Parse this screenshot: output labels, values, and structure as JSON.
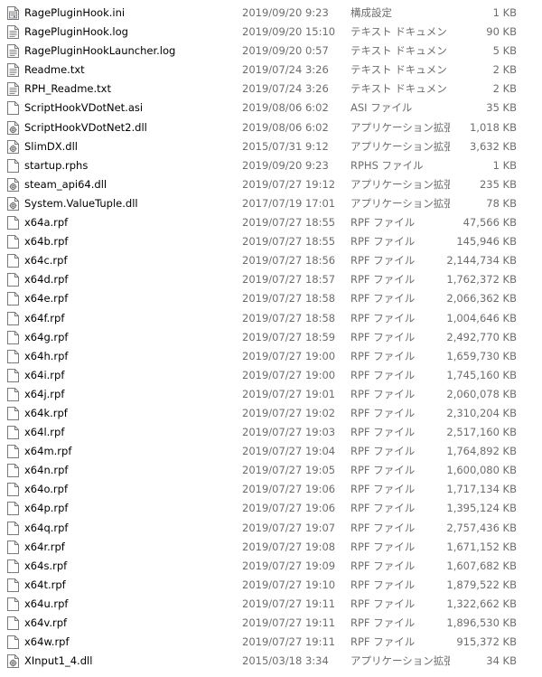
{
  "files": [
    {
      "name": "RagePluginHook.ini",
      "date": "2019/09/20 9:23",
      "type": "構成設定",
      "size": "1 KB",
      "icon": "settings-file-icon"
    },
    {
      "name": "RagePluginHook.log",
      "date": "2019/09/20 15:10",
      "type": "テキスト ドキュメント",
      "size": "90 KB",
      "icon": "text-file-icon"
    },
    {
      "name": "RagePluginHookLauncher.log",
      "date": "2019/09/20 0:57",
      "type": "テキスト ドキュメント",
      "size": "5 KB",
      "icon": "text-file-icon"
    },
    {
      "name": "Readme.txt",
      "date": "2019/07/24 3:26",
      "type": "テキスト ドキュメント",
      "size": "2 KB",
      "icon": "text-file-icon"
    },
    {
      "name": "RPH_Readme.txt",
      "date": "2019/07/24 3:26",
      "type": "テキスト ドキュメント",
      "size": "2 KB",
      "icon": "text-file-icon"
    },
    {
      "name": "ScriptHookVDotNet.asi",
      "date": "2019/08/06 6:02",
      "type": "ASI ファイル",
      "size": "35 KB",
      "icon": "blank-file-icon"
    },
    {
      "name": "ScriptHookVDotNet2.dll",
      "date": "2019/08/06 6:02",
      "type": "アプリケーション拡張",
      "size": "1,018 KB",
      "icon": "dll-file-icon"
    },
    {
      "name": "SlimDX.dll",
      "date": "2015/07/31 9:12",
      "type": "アプリケーション拡張",
      "size": "3,632 KB",
      "icon": "dll-file-icon"
    },
    {
      "name": "startup.rphs",
      "date": "2019/09/20 9:23",
      "type": "RPHS ファイル",
      "size": "1 KB",
      "icon": "blank-file-icon"
    },
    {
      "name": "steam_api64.dll",
      "date": "2019/07/27 19:12",
      "type": "アプリケーション拡張",
      "size": "235 KB",
      "icon": "dll-file-icon"
    },
    {
      "name": "System.ValueTuple.dll",
      "date": "2017/07/19 17:01",
      "type": "アプリケーション拡張",
      "size": "78 KB",
      "icon": "dll-file-icon"
    },
    {
      "name": "x64a.rpf",
      "date": "2019/07/27 18:55",
      "type": "RPF ファイル",
      "size": "47,566 KB",
      "icon": "blank-file-icon"
    },
    {
      "name": "x64b.rpf",
      "date": "2019/07/27 18:55",
      "type": "RPF ファイル",
      "size": "145,946 KB",
      "icon": "blank-file-icon"
    },
    {
      "name": "x64c.rpf",
      "date": "2019/07/27 18:56",
      "type": "RPF ファイル",
      "size": "2,144,734 KB",
      "icon": "blank-file-icon"
    },
    {
      "name": "x64d.rpf",
      "date": "2019/07/27 18:57",
      "type": "RPF ファイル",
      "size": "1,762,372 KB",
      "icon": "blank-file-icon"
    },
    {
      "name": "x64e.rpf",
      "date": "2019/07/27 18:58",
      "type": "RPF ファイル",
      "size": "2,066,362 KB",
      "icon": "blank-file-icon"
    },
    {
      "name": "x64f.rpf",
      "date": "2019/07/27 18:58",
      "type": "RPF ファイル",
      "size": "1,004,646 KB",
      "icon": "blank-file-icon"
    },
    {
      "name": "x64g.rpf",
      "date": "2019/07/27 18:59",
      "type": "RPF ファイル",
      "size": "2,492,770 KB",
      "icon": "blank-file-icon"
    },
    {
      "name": "x64h.rpf",
      "date": "2019/07/27 19:00",
      "type": "RPF ファイル",
      "size": "1,659,730 KB",
      "icon": "blank-file-icon"
    },
    {
      "name": "x64i.rpf",
      "date": "2019/07/27 19:00",
      "type": "RPF ファイル",
      "size": "1,745,160 KB",
      "icon": "blank-file-icon"
    },
    {
      "name": "x64j.rpf",
      "date": "2019/07/27 19:01",
      "type": "RPF ファイル",
      "size": "2,060,078 KB",
      "icon": "blank-file-icon"
    },
    {
      "name": "x64k.rpf",
      "date": "2019/07/27 19:02",
      "type": "RPF ファイル",
      "size": "2,310,204 KB",
      "icon": "blank-file-icon"
    },
    {
      "name": "x64l.rpf",
      "date": "2019/07/27 19:03",
      "type": "RPF ファイル",
      "size": "2,517,160 KB",
      "icon": "blank-file-icon"
    },
    {
      "name": "x64m.rpf",
      "date": "2019/07/27 19:04",
      "type": "RPF ファイル",
      "size": "1,764,892 KB",
      "icon": "blank-file-icon"
    },
    {
      "name": "x64n.rpf",
      "date": "2019/07/27 19:05",
      "type": "RPF ファイル",
      "size": "1,600,080 KB",
      "icon": "blank-file-icon"
    },
    {
      "name": "x64o.rpf",
      "date": "2019/07/27 19:06",
      "type": "RPF ファイル",
      "size": "1,717,134 KB",
      "icon": "blank-file-icon"
    },
    {
      "name": "x64p.rpf",
      "date": "2019/07/27 19:06",
      "type": "RPF ファイル",
      "size": "1,395,124 KB",
      "icon": "blank-file-icon"
    },
    {
      "name": "x64q.rpf",
      "date": "2019/07/27 19:07",
      "type": "RPF ファイル",
      "size": "2,757,436 KB",
      "icon": "blank-file-icon"
    },
    {
      "name": "x64r.rpf",
      "date": "2019/07/27 19:08",
      "type": "RPF ファイル",
      "size": "1,671,152 KB",
      "icon": "blank-file-icon"
    },
    {
      "name": "x64s.rpf",
      "date": "2019/07/27 19:09",
      "type": "RPF ファイル",
      "size": "1,607,682 KB",
      "icon": "blank-file-icon"
    },
    {
      "name": "x64t.rpf",
      "date": "2019/07/27 19:10",
      "type": "RPF ファイル",
      "size": "1,879,522 KB",
      "icon": "blank-file-icon"
    },
    {
      "name": "x64u.rpf",
      "date": "2019/07/27 19:11",
      "type": "RPF ファイル",
      "size": "1,322,662 KB",
      "icon": "blank-file-icon"
    },
    {
      "name": "x64v.rpf",
      "date": "2019/07/27 19:11",
      "type": "RPF ファイル",
      "size": "1,896,530 KB",
      "icon": "blank-file-icon"
    },
    {
      "name": "x64w.rpf",
      "date": "2019/07/27 19:11",
      "type": "RPF ファイル",
      "size": "915,372 KB",
      "icon": "blank-file-icon"
    },
    {
      "name": "XInput1_4.dll",
      "date": "2015/03/18 3:34",
      "type": "アプリケーション拡張",
      "size": "34 KB",
      "icon": "dll-file-icon"
    }
  ]
}
